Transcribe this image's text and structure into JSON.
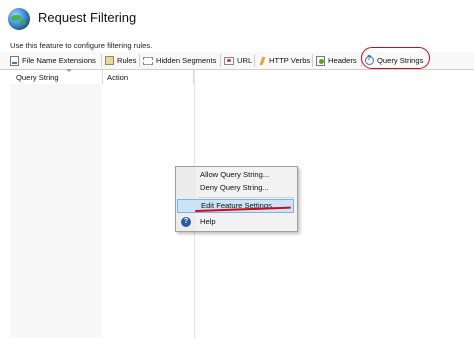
{
  "header": {
    "title": "Request Filtering",
    "description": "Use this feature to configure filtering rules."
  },
  "tabs": [
    {
      "label": "File Name Extensions",
      "icon": "file-extension-icon"
    },
    {
      "label": "Rules",
      "icon": "rules-icon"
    },
    {
      "label": "Hidden Segments",
      "icon": "hidden-segments-icon"
    },
    {
      "label": "URL",
      "icon": "url-icon"
    },
    {
      "label": "HTTP Verbs",
      "icon": "http-verbs-icon"
    },
    {
      "label": "Headers",
      "icon": "headers-icon"
    },
    {
      "label": "Query Strings",
      "icon": "query-strings-icon",
      "selected": true
    }
  ],
  "grid": {
    "columns": [
      "Query String",
      "Action"
    ]
  },
  "context_menu": {
    "items": [
      "Allow Query String...",
      "Deny Query String...",
      "Edit Feature Settings...",
      "Help"
    ],
    "highlighted_item": "Edit Feature Settings..."
  },
  "annotation_color": "#d10a1a"
}
